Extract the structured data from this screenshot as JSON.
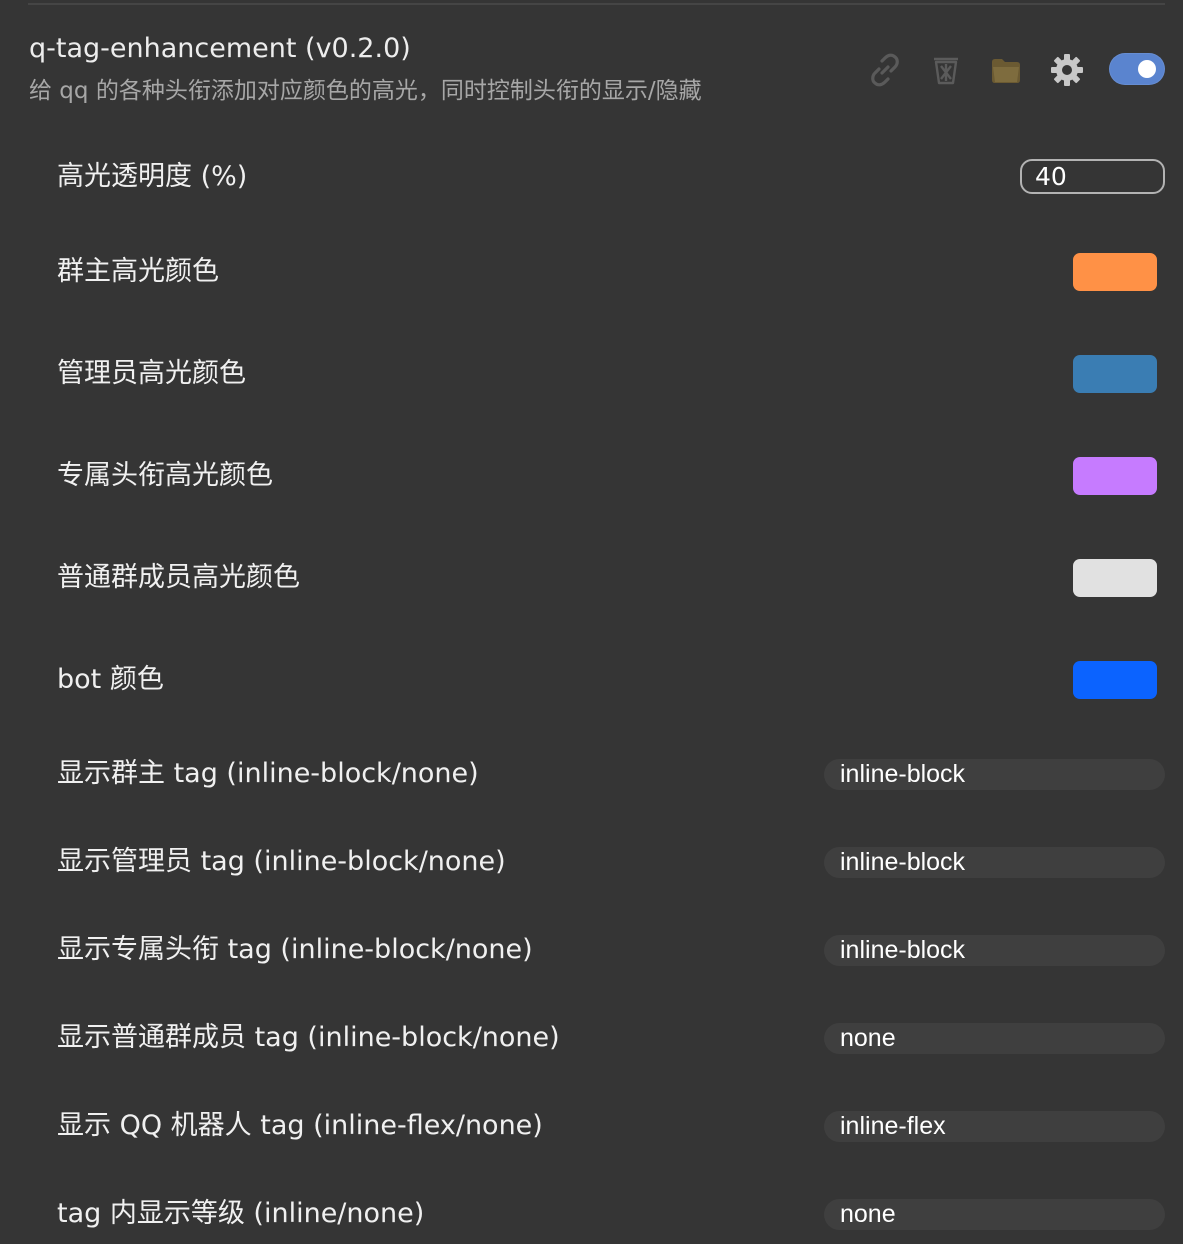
{
  "plugin": {
    "title": "q-tag-enhancement (v0.2.0)",
    "description": "给 qq 的各种头衔添加对应颜色的高光，同时控制头衔的显示/隐藏",
    "enabled": true
  },
  "actions": {
    "icons": [
      "link-icon",
      "trash-icon",
      "folder-icon",
      "gear-icon"
    ]
  },
  "settings": [
    {
      "label": "高光透明度 (%)",
      "type": "number",
      "value": "40"
    },
    {
      "label": "群主高光颜色",
      "type": "color",
      "value": "#ff9146"
    },
    {
      "label": "管理员高光颜色",
      "type": "color",
      "value": "#3a7db3"
    },
    {
      "label": "专属头衔高光颜色",
      "type": "color",
      "value": "#c67bff"
    },
    {
      "label": "普通群成员高光颜色",
      "type": "color",
      "value": "#e1e1e1"
    },
    {
      "label": "bot 颜色",
      "type": "color",
      "value": "#0b63ff"
    },
    {
      "label": "显示群主 tag (inline-block/none)",
      "type": "text",
      "value": "inline-block"
    },
    {
      "label": "显示管理员 tag (inline-block/none)",
      "type": "text",
      "value": "inline-block"
    },
    {
      "label": "显示专属头衔 tag (inline-block/none)",
      "type": "text",
      "value": "inline-block"
    },
    {
      "label": "显示普通群成员 tag (inline-block/none)",
      "type": "text",
      "value": "none"
    },
    {
      "label": "显示 QQ 机器人 tag (inline-flex/none)",
      "type": "text",
      "value": "inline-flex"
    },
    {
      "label": "tag 内显示等级 (inline/none)",
      "type": "text",
      "value": "none"
    }
  ],
  "colors": {
    "background": "#353535",
    "toggle": "#5a84cf",
    "text": "#f0f0f0",
    "muted_text": "#a7a7a7"
  }
}
